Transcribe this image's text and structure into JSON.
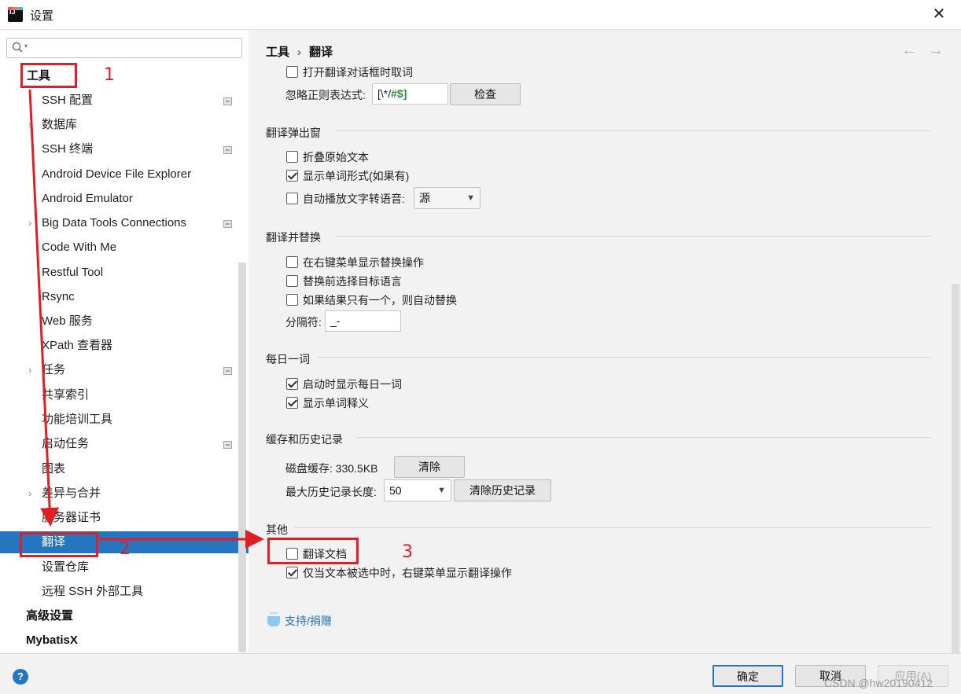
{
  "window": {
    "title": "设置",
    "close_glyph": "✕"
  },
  "search": {
    "placeholder": ""
  },
  "sidebar": {
    "tools": "工具",
    "items": [
      "SSH 配置",
      "数据库",
      "SSH 终端",
      "Android Device File Explorer",
      "Android Emulator",
      "Big Data Tools Connections",
      "Code With Me",
      "Restful Tool",
      "Rsync",
      "Web 服务",
      "XPath 查看器",
      "任务",
      "共享索引",
      "功能培训工具",
      "启动任务",
      "图表",
      "差异与合并",
      "服务器证书",
      "翻译",
      "设置仓库",
      "远程 SSH 外部工具"
    ],
    "advanced": "高级设置",
    "mybatisx": "MybatisX"
  },
  "breadcrumb": {
    "parent": "工具",
    "separator": "›",
    "current": "翻译"
  },
  "top": {
    "open_dialog_cb": "打开翻译对话框时取词",
    "ignore_regex_label": "忽略正则表达式:",
    "regex_part1": "[\\*/",
    "regex_part2": "#$]",
    "check_button": "检查"
  },
  "popup": {
    "title": "翻译弹出窗",
    "fold_cb": "折叠原始文本",
    "show_forms_cb": "显示单词形式(如果有)",
    "autoplay_cb": "自动播放文字转语音:",
    "autoplay_select": "源"
  },
  "replace": {
    "title": "翻译并替换",
    "show_in_menu_cb": "在右键菜单显示替换操作",
    "choose_lang_cb": "替换前选择目标语言",
    "auto_replace_cb": "如果结果只有一个，则自动替换",
    "separator_label": "分隔符:",
    "separator_value": "_-"
  },
  "daily": {
    "title": "每日一词",
    "show_on_start_cb": "启动时显示每日一词",
    "show_explain_cb": "显示单词释义"
  },
  "cache": {
    "title": "缓存和历史记录",
    "disk_cache_label": "磁盘缓存: 330.5KB",
    "clear_button": "清除",
    "max_history_label": "最大历史记录长度:",
    "max_history_value": "50",
    "clear_history_button": "清除历史记录"
  },
  "other": {
    "title": "其他",
    "translate_doc_cb": "翻译文档",
    "only_selected_cb": "仅当文本被选中时，右键菜单显示翻译操作"
  },
  "support_link": "支持/捐赠",
  "footer": {
    "help": "?",
    "ok": "确定",
    "cancel": "取消",
    "apply": "应用(A)"
  },
  "watermark": "CSDN @hw20190412",
  "annotations": {
    "n1": "1",
    "n2": "2",
    "n3": "3"
  },
  "nav": {
    "back": "←",
    "forward": "→"
  },
  "colors": {
    "accent": "#2675bf",
    "annotation": "#e01e26"
  },
  "icons": {
    "app": "intellij-icon",
    "search": "search-icon",
    "support": "cup-icon"
  }
}
